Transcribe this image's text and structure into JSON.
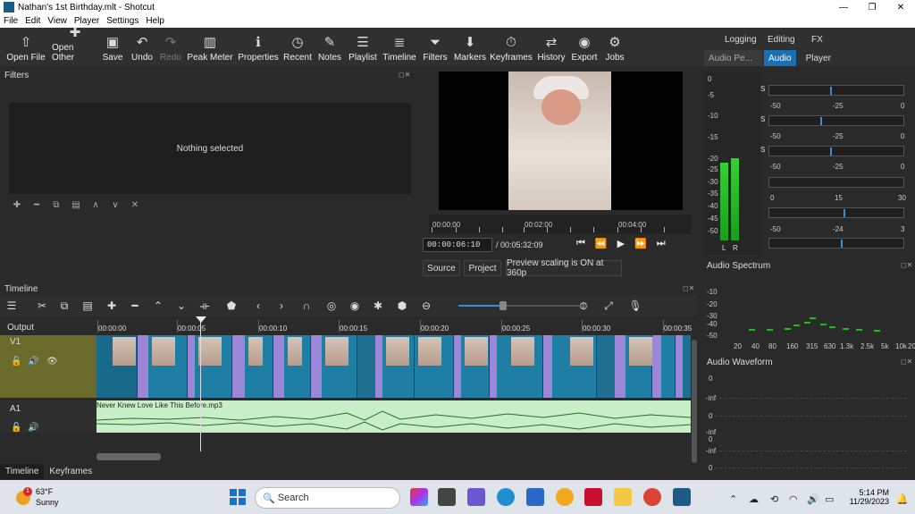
{
  "window": {
    "title": "Nathan's 1st Birthday.mlt - Shotcut",
    "controls": [
      "—",
      "❐",
      "✕"
    ]
  },
  "menu": [
    "File",
    "Edit",
    "View",
    "Player",
    "Settings",
    "Help"
  ],
  "toolbar": [
    {
      "label": "Open File",
      "icon": "⇧"
    },
    {
      "label": "Open Other",
      "icon": "✚"
    },
    {
      "label": "Save",
      "icon": "▣"
    },
    {
      "label": "Undo",
      "icon": "↶"
    },
    {
      "label": "Redo",
      "icon": "↷"
    },
    {
      "label": "Peak Meter",
      "icon": "▥"
    },
    {
      "label": "Properties",
      "icon": "ℹ"
    },
    {
      "label": "Recent",
      "icon": "◷"
    },
    {
      "label": "Notes",
      "icon": "✎"
    },
    {
      "label": "Playlist",
      "icon": "☰"
    },
    {
      "label": "Timeline",
      "icon": "≣"
    },
    {
      "label": "Filters",
      "icon": "⏷"
    },
    {
      "label": "Markers",
      "icon": "⬇"
    },
    {
      "label": "Keyframes",
      "icon": "⏱"
    },
    {
      "label": "History",
      "icon": "⇄"
    },
    {
      "label": "Export",
      "icon": "◉"
    },
    {
      "label": "Jobs",
      "icon": "⚙"
    }
  ],
  "layouts": {
    "logging": "Logging",
    "editing": "Editing",
    "fx": "FX"
  },
  "right_tabs": {
    "audio_peak": "Audio Pe...",
    "audio": "Audio",
    "player": "Player"
  },
  "filters": {
    "title": "Filters",
    "empty": "Nothing selected"
  },
  "ruler": [
    "00:00:00",
    "00:02:00",
    "00:04:00"
  ],
  "player": {
    "position": "00:00:06:10",
    "duration": "/ 00:05:32:09",
    "source": "Source",
    "project": "Project",
    "scaling": "Preview scaling is ON at 360p"
  },
  "meter": {
    "labels": [
      "0",
      "-5",
      "-10",
      "-15",
      "-20",
      "-25",
      "-30",
      "-35",
      "-40",
      "-45",
      "-50"
    ],
    "left": "L",
    "right": "R",
    "level_left": 0.62,
    "level_right": 0.66
  },
  "sliders": [
    {
      "labels": [
        "-50",
        "-25",
        "0"
      ],
      "pos": 0.45
    },
    {
      "labels": [
        "-50",
        "-25",
        "0"
      ],
      "pos": 0.38
    },
    {
      "labels": [
        "-50",
        "-25",
        "0"
      ],
      "pos": 0.45
    },
    {
      "labels": [
        "0",
        "15",
        "30"
      ],
      "pos": 0.55
    },
    {
      "labels": [
        "-50",
        "-24",
        "3"
      ],
      "pos": 0.53
    }
  ],
  "spectrum": {
    "title": "Audio Spectrum",
    "ylabels": [
      "-10",
      "-20",
      "-30",
      "-40",
      "-50"
    ],
    "xlabels": [
      "20",
      "40",
      "80",
      "160",
      "315",
      "630",
      "1.3k",
      "2.5k",
      "5k",
      "10k",
      "20k"
    ]
  },
  "waveform": {
    "title": "Audio Waveform",
    "labels": [
      "0",
      "-inf",
      "0",
      "-inf",
      "0",
      "-inf",
      "0"
    ]
  },
  "timeline": {
    "title": "Timeline",
    "output": "Output",
    "v1": "V1",
    "a1": "A1",
    "ruler": [
      "00:00:00",
      "00:00:05",
      "00:00:10",
      "00:00:15",
      "00:00:20",
      "00:00:25",
      "00:00:30",
      "00:00:35"
    ],
    "audio_clip": "Never Knew Love Like This Before.mp3"
  },
  "bottom_tabs": [
    "Timeline",
    "Keyframes"
  ],
  "taskbar": {
    "temp": "63°F",
    "weather": "Sunny",
    "search": "Search",
    "time": "5:14 PM",
    "date": "11/29/2023",
    "badge": "1"
  },
  "colors": {
    "accent": "#3b8fd5",
    "v1_track": "#1e6f90",
    "transition": "#9b86d8",
    "audio_clip": "#c8eec8",
    "meter": "#36d036"
  }
}
